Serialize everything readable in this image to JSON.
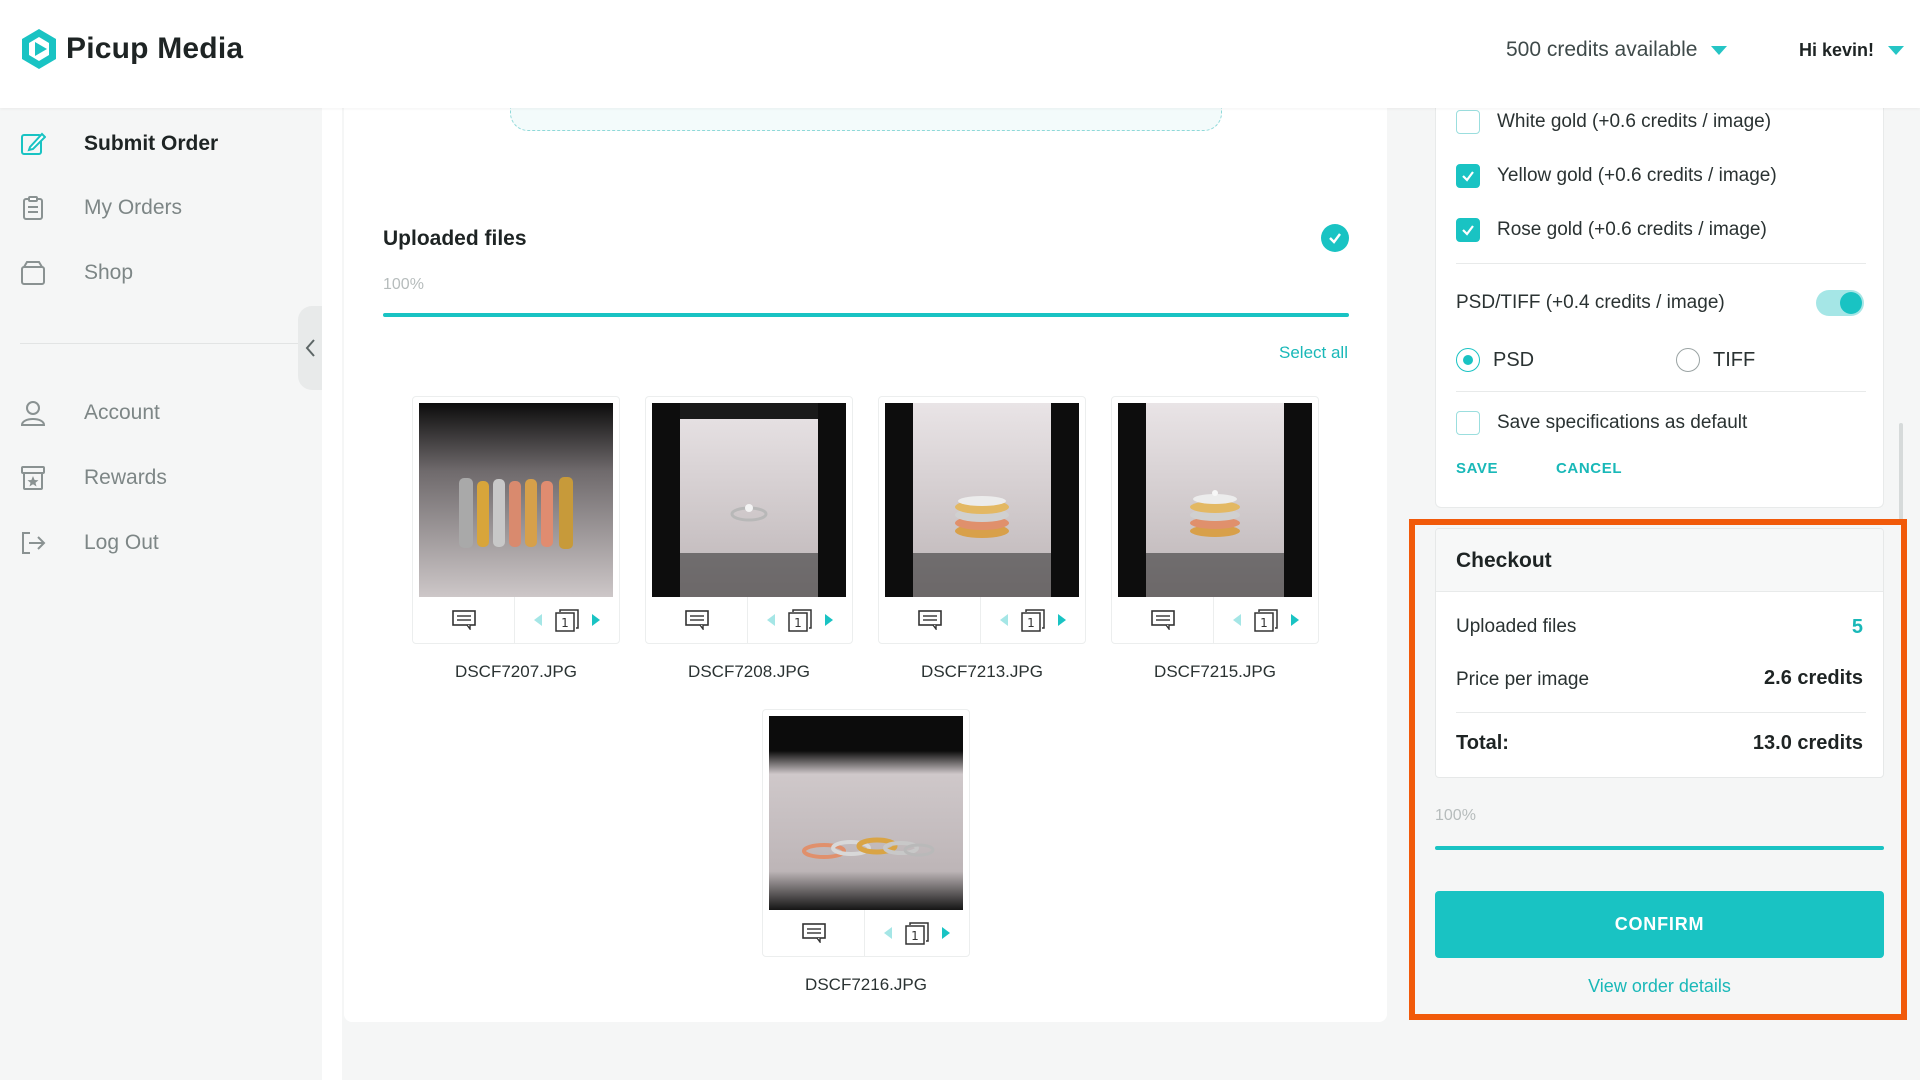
{
  "app": {
    "name": "Picup Media",
    "credits_label": "500 credits available",
    "greeting": "Hi kevin!"
  },
  "sidebar": {
    "items": [
      {
        "label": "Submit Order",
        "icon": "edit-icon"
      },
      {
        "label": "My Orders",
        "icon": "clipboard-icon"
      },
      {
        "label": "Shop",
        "icon": "shop-icon"
      },
      {
        "label": "Account",
        "icon": "user-icon"
      },
      {
        "label": "Rewards",
        "icon": "rewards-icon"
      },
      {
        "label": "Log Out",
        "icon": "logout-icon"
      }
    ]
  },
  "uploads": {
    "title": "Uploaded files",
    "progress_label": "100%",
    "progress": 1.0,
    "select_all": "Select all",
    "files": [
      {
        "name": "DSCF7207.JPG",
        "page": "1"
      },
      {
        "name": "DSCF7208.JPG",
        "page": "1"
      },
      {
        "name": "DSCF7213.JPG",
        "page": "1"
      },
      {
        "name": "DSCF7215.JPG",
        "page": "1"
      },
      {
        "name": "DSCF7216.JPG",
        "page": "1"
      }
    ]
  },
  "specs": {
    "options": [
      {
        "label": "White gold (+0.6 credits / image)",
        "checked": false
      },
      {
        "label": "Yellow gold (+0.6 credits / image)",
        "checked": true
      },
      {
        "label": "Rose gold (+0.6 credits / image)",
        "checked": true
      }
    ],
    "psd_tiff_label": "PSD/TIFF (+0.4 credits / image)",
    "psd_tiff_enabled": true,
    "formats": [
      {
        "label": "PSD",
        "selected": true
      },
      {
        "label": "TIFF",
        "selected": false
      }
    ],
    "save_default_label": "Save specifications as default",
    "save_default_checked": false,
    "save_label": "SAVE",
    "cancel_label": "CANCEL"
  },
  "checkout": {
    "title": "Checkout",
    "uploaded_files_label": "Uploaded files",
    "uploaded_files_count": "5",
    "price_label": "Price per image",
    "price_value": "2.6 credits",
    "total_label": "Total:",
    "total_value": "13.0 credits",
    "progress_label": "100%",
    "progress": 1.0,
    "confirm_label": "CONFIRM",
    "view_details_label": "View order details"
  },
  "colors": {
    "accent": "#19c3c3",
    "highlight": "#f15a0a"
  }
}
